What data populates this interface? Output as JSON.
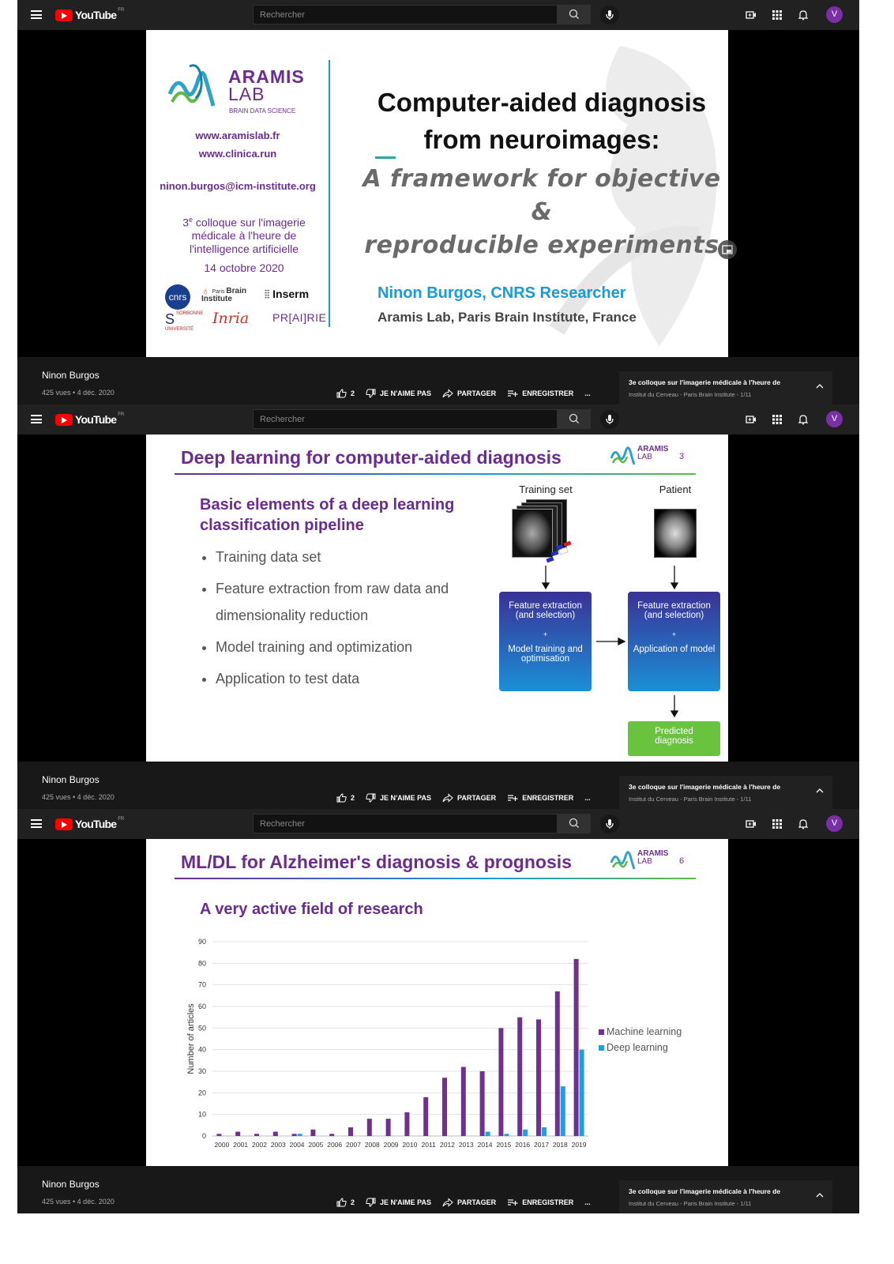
{
  "youtube": {
    "logo_text": "YouTube",
    "logo_region": "FR",
    "search_placeholder": "Rechercher",
    "avatar_letter": "V",
    "channel": "Ninon Burgos",
    "views_date": "425 vues • 4 déc. 2020",
    "like_count": "2",
    "dislike_label": "JE N'AIME PAS",
    "share_label": "PARTAGER",
    "save_label": "ENREGISTRER",
    "more_label": "...",
    "playlist_title": "3e colloque sur l'imagerie médicale à l'heure de",
    "playlist_subtitle": "Institut du Cerveau - Paris Brain Institute - 1/11",
    "colors": {
      "brand_red": "#ff0000",
      "avatar": "#7b2fa6",
      "topbar": "#212121",
      "infobar": "#181818"
    },
    "icons": [
      "menu-icon",
      "search-icon",
      "mic-icon",
      "create-video-icon",
      "apps-icon",
      "bell-icon",
      "like-icon",
      "dislike-icon",
      "share-icon",
      "save-icon",
      "chevron-up-icon"
    ]
  },
  "slide1": {
    "lab_name_1": "ARAMIS",
    "lab_name_2": "LAB",
    "lab_tagline": "BRAIN DATA SCIENCE",
    "url1": "www.aramislab.fr",
    "url2": "www.clinica.run",
    "email": "ninon.burgos@icm-institute.org",
    "event_sup": "e",
    "event_num": "3",
    "event_line1": " colloque sur l'imagerie",
    "event_line2": "médicale à l'heure de",
    "event_line3": "l'intelligence artificielle",
    "event_date": "14 octobre 2020",
    "logos": {
      "cnrs": "cnrs",
      "pbi_small": "Paris",
      "pbi_1": "Brain",
      "pbi_2": "Institute",
      "inserm": "Inserm",
      "sorbonne_1": "SORBONNE",
      "sorbonne_2": "UNIVERSITÉ",
      "inria": "Inria",
      "prairie": "PR[AI]RIE"
    },
    "title_line1": "Computer-aided diagnosis",
    "title_line2": "from neuroimages:",
    "subtitle_line1": "A framework for objective &",
    "subtitle_line2": "reproducible experiments",
    "speaker": "Ninon Burgos, CNRS Researcher",
    "affiliation": "Aramis Lab, Paris Brain Institute, France"
  },
  "slide2": {
    "title": "Deep learning for computer-aided diagnosis",
    "page_number": "3",
    "logo_1": "ARAMIS",
    "logo_2": "LAB",
    "section": "Basic elements of a deep learning classification pipeline",
    "bullets": [
      "Training data set",
      "Feature extraction from raw data and dimensionality reduction",
      "Model training and optimization",
      "Application to test data"
    ],
    "training_label": "Training set",
    "patient_label": "Patient",
    "box_left_1": "Feature extraction (and selection)",
    "box_left_plus": "+",
    "box_left_2": "Model training and optimisation",
    "box_right_1": "Feature extraction (and selection)",
    "box_right_plus": "+",
    "box_right_2": "Application of model",
    "predicted": "Predicted diagnosis",
    "colors": {
      "box": "#2f3a9a",
      "box2": "#1b8fd6",
      "green": "#6ac33f",
      "title": "#6b2c91"
    }
  },
  "slide3": {
    "title": "ML/DL for Alzheimer's diagnosis & prognosis",
    "page_number": "6",
    "logo_1": "ARAMIS",
    "logo_2": "LAB",
    "subtitle": "A very active field of research"
  },
  "chart_data": {
    "type": "bar",
    "title": "",
    "xlabel": "",
    "ylabel": "Number of articles",
    "ylim": [
      0,
      90
    ],
    "yticks": [
      0,
      10,
      20,
      30,
      40,
      50,
      60,
      70,
      80,
      90
    ],
    "grid": true,
    "legend_position": "right",
    "categories": [
      "2000",
      "2001",
      "2002",
      "2003",
      "2004",
      "2005",
      "2006",
      "2007",
      "2008",
      "2009",
      "2010",
      "2011",
      "2012",
      "2013",
      "2014",
      "2015",
      "2016",
      "2017",
      "2018",
      "2019"
    ],
    "series": [
      {
        "name": "Machine learning",
        "color": "#70308f",
        "values": [
          1,
          2,
          1,
          2,
          1,
          3,
          1,
          4,
          8,
          8,
          11,
          18,
          27,
          32,
          30,
          50,
          55,
          54,
          67,
          82
        ]
      },
      {
        "name": "Deep learning",
        "color": "#1ea0dc",
        "values": [
          0,
          0,
          0,
          0,
          1,
          0,
          0,
          0,
          0,
          0,
          0,
          0,
          0,
          0,
          2,
          1,
          3,
          4,
          23,
          40
        ]
      }
    ]
  }
}
